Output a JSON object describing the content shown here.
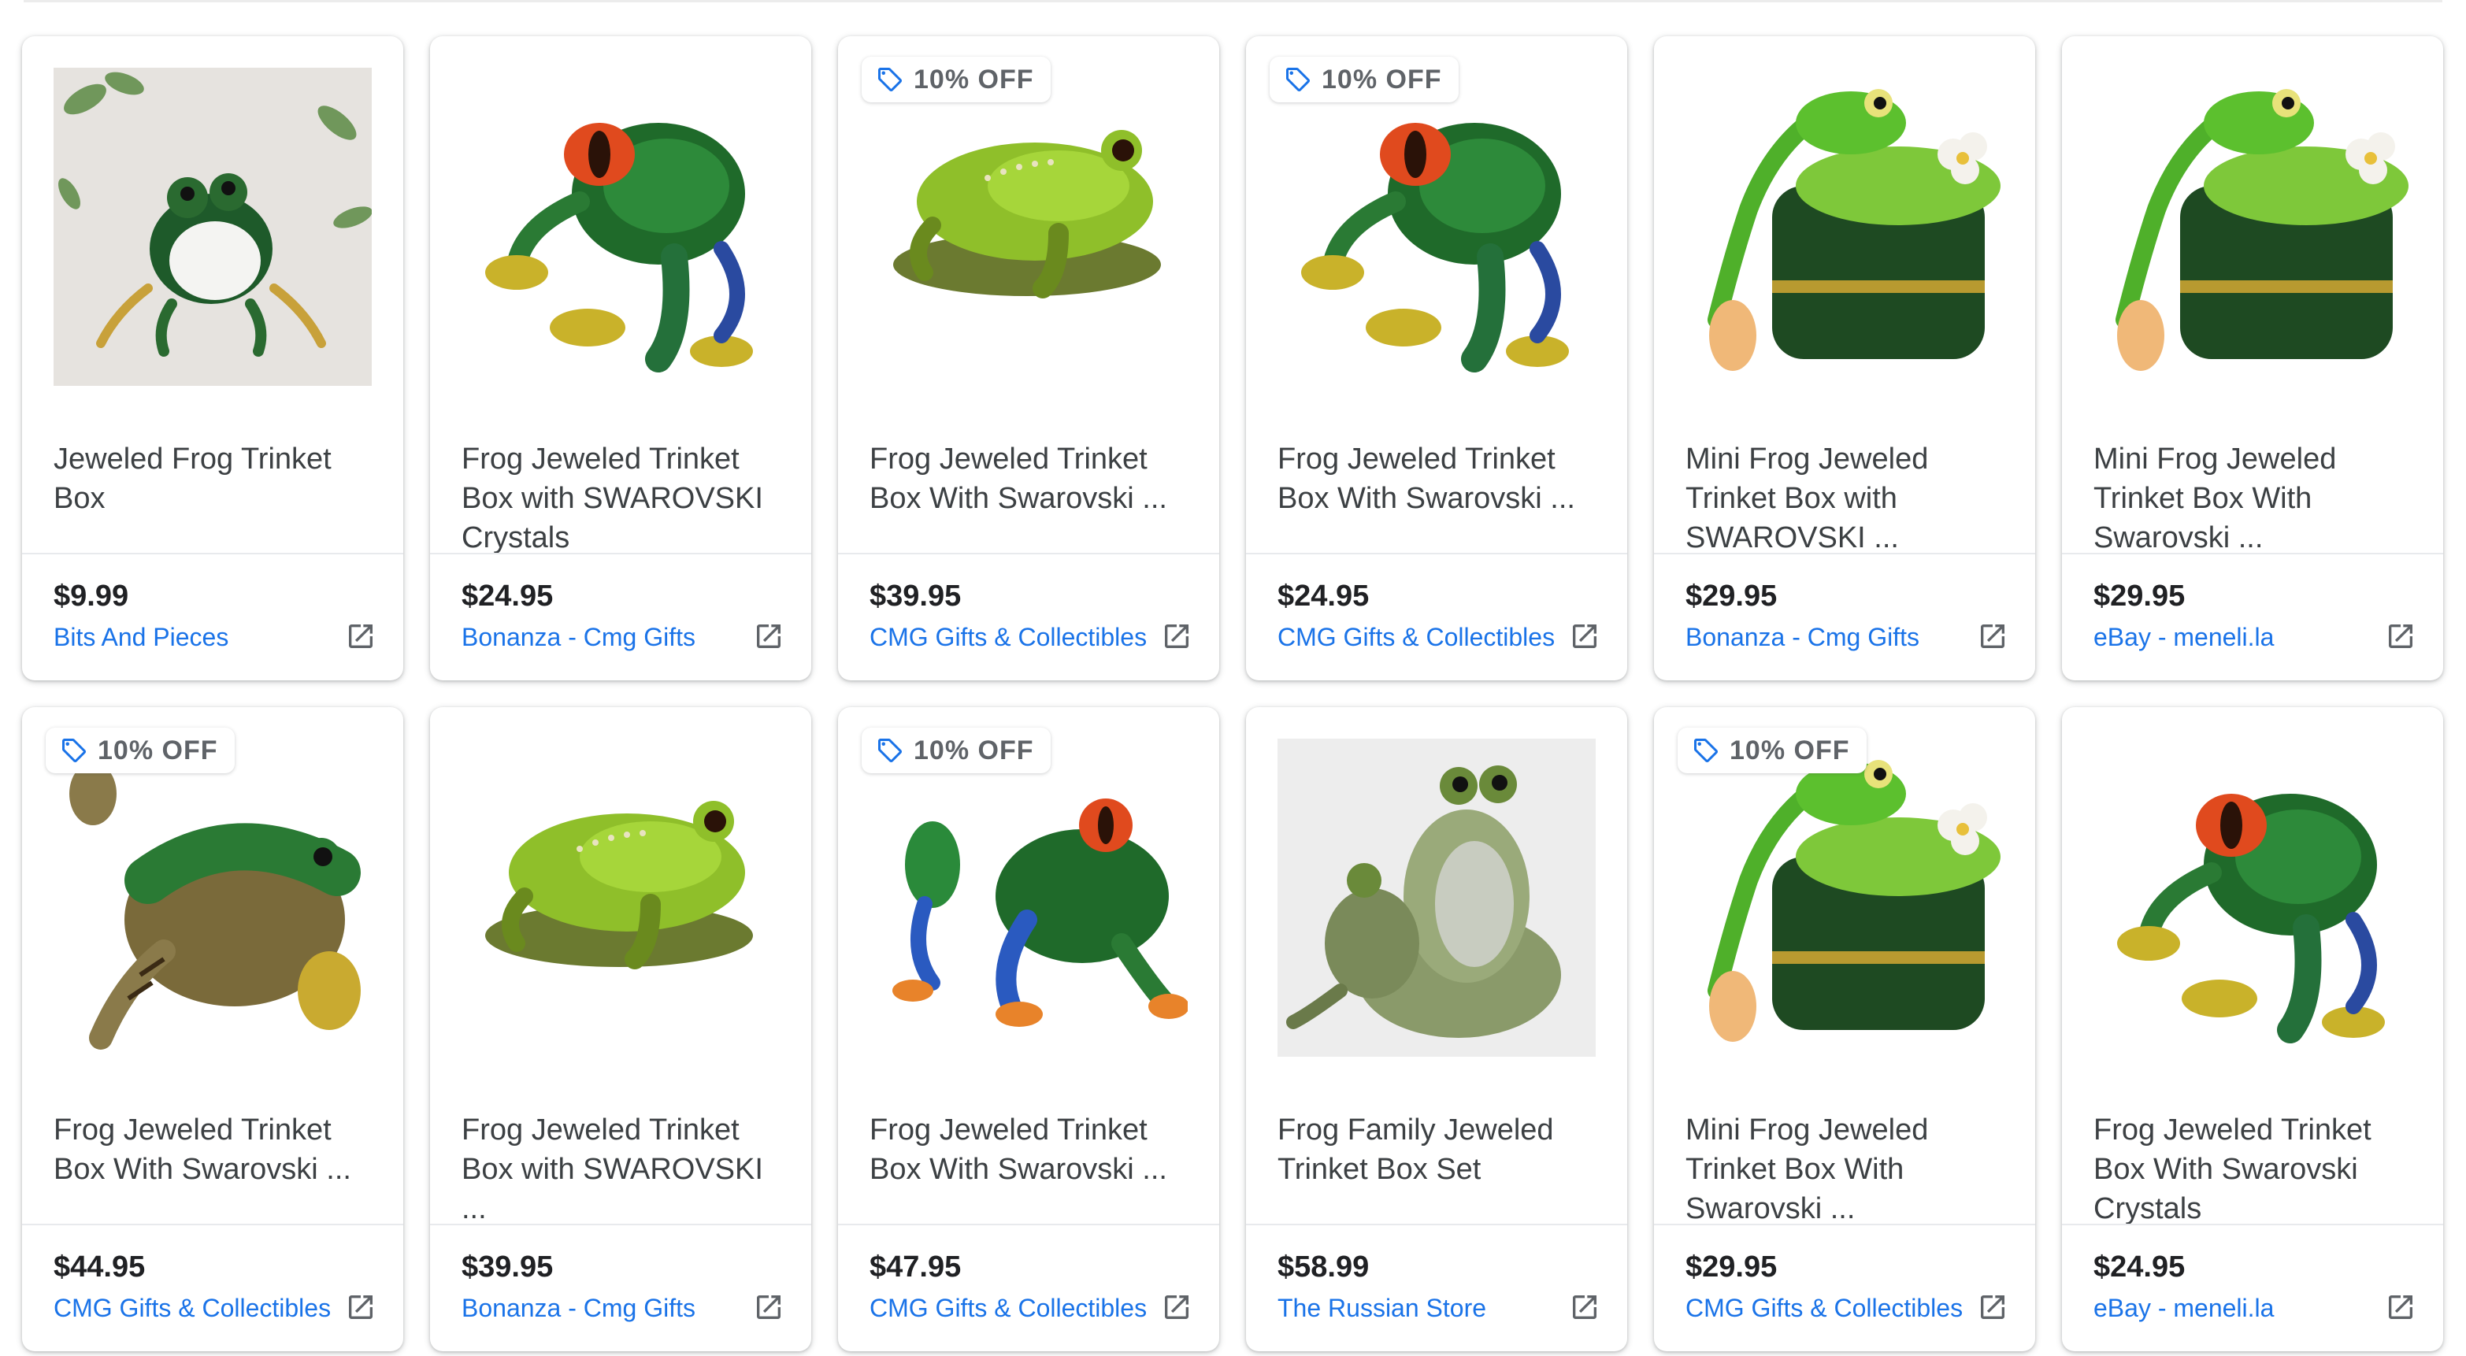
{
  "colors": {
    "title": "#3c4043",
    "price": "#202124",
    "seller": "#1a73e8",
    "badge_icon": "#1a73e8"
  },
  "badge_icon": "tag-icon",
  "external_icon": "open-in-new-icon",
  "products": [
    {
      "title": "Jeweled Frog Trinket Box",
      "price": "$9.99",
      "seller": "Bits And Pieces",
      "badge": "",
      "image": "frog-photo-with-leaves"
    },
    {
      "title": "Frog Jeweled Trinket Box with SWAROVSKI Crystals",
      "price": "$24.95",
      "seller": "Bonanza - Cmg Gifts",
      "badge": "",
      "image": "red-eyed-tree-frog"
    },
    {
      "title": "Frog Jeweled Trinket Box With Swarovski ...",
      "price": "$39.95",
      "seller": "CMG Gifts & Collectibles",
      "badge": "10% OFF",
      "image": "sitting-green-frog"
    },
    {
      "title": "Frog Jeweled Trinket Box With Swarovski ...",
      "price": "$24.95",
      "seller": "CMG Gifts & Collectibles",
      "badge": "10% OFF",
      "image": "red-eyed-tree-frog"
    },
    {
      "title": "Mini Frog Jeweled Trinket Box with SWAROVSKI ...",
      "price": "$29.95",
      "seller": "Bonanza - Cmg Gifts",
      "badge": "",
      "image": "frog-on-box-with-flower"
    },
    {
      "title": "Mini Frog Jeweled Trinket Box With Swarovski ...",
      "price": "$29.95",
      "seller": "eBay - meneli.la",
      "badge": "",
      "image": "frog-on-box-with-flower"
    },
    {
      "title": "Frog Jeweled Trinket Box With Swarovski ...",
      "price": "$44.95",
      "seller": "CMG Gifts & Collectibles",
      "badge": "10% OFF",
      "image": "brown-striped-frog"
    },
    {
      "title": "Frog Jeweled Trinket Box with SWAROVSKI ...",
      "price": "$39.95",
      "seller": "Bonanza - Cmg Gifts",
      "badge": "",
      "image": "sitting-green-frog"
    },
    {
      "title": "Frog Jeweled Trinket Box With Swarovski ...",
      "price": "$47.95",
      "seller": "CMG Gifts & Collectibles",
      "badge": "10% OFF",
      "image": "red-eyed-tree-frog-two-views"
    },
    {
      "title": "Frog Family Jeweled Trinket Box Set",
      "price": "$58.99",
      "seller": "The Russian Store",
      "badge": "",
      "image": "frog-family"
    },
    {
      "title": "Mini Frog Jeweled Trinket Box With Swarovski ...",
      "price": "$29.95",
      "seller": "CMG Gifts & Collectibles",
      "badge": "10% OFF",
      "image": "frog-on-box-with-flower"
    },
    {
      "title": "Frog Jeweled Trinket Box With Swarovski Crystals",
      "price": "$24.95",
      "seller": "eBay - meneli.la",
      "badge": "",
      "image": "red-eyed-tree-frog"
    }
  ]
}
